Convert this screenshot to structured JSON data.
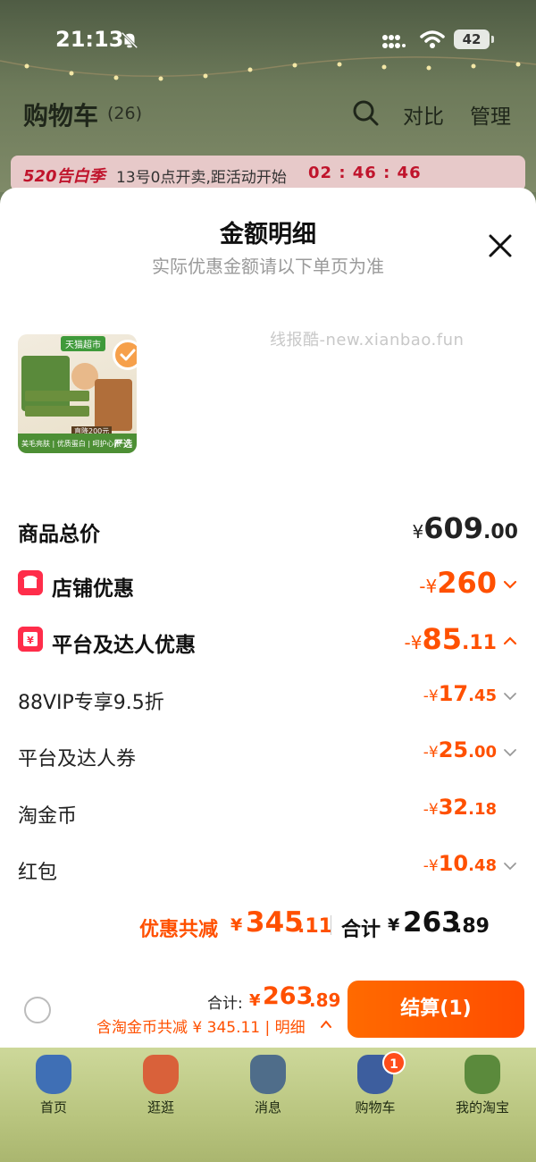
{
  "status_bar": {
    "time": "21:13",
    "battery": "42"
  },
  "cart_header": {
    "title": "购物车",
    "count": "(26)",
    "compare_label": "对比",
    "manage_label": "管理"
  },
  "promo": {
    "tag": "520告白季",
    "text": "13号0点开卖,距活动开始",
    "timer": "02 : 46 : 46"
  },
  "sheet": {
    "title": "金额明细",
    "subtitle": "实际优惠金额请以下单页为准",
    "watermark": "线报酷-new.xianbao.fun",
    "product_image": {
      "store_badge": "天猫超市",
      "tag": "直降200元",
      "footer": "美毛亮肤 | 优质蛋白 | 呵护心眼",
      "select_badge": "严选"
    },
    "rows": [
      {
        "label": "商品总价",
        "yen": "¥",
        "int": "609",
        "dec": ".00"
      },
      {
        "label": "店铺优惠",
        "icon": "store-discount-icon",
        "yen": "-¥",
        "int": "260",
        "dec": ""
      },
      {
        "label": "平台及达人优惠",
        "icon": "coupon-icon",
        "yen": "-¥",
        "int": "85",
        "dec": ".11"
      },
      {
        "label": "88VIP专享9.5折",
        "yen": "-¥",
        "int": "17",
        "dec": ".45"
      },
      {
        "label": "平台及达人券",
        "yen": "-¥",
        "int": "25",
        "dec": ".00"
      },
      {
        "label": "淘金币",
        "yen": "-¥",
        "int": "32",
        "dec": ".18"
      },
      {
        "label": "红包",
        "yen": "-¥",
        "int": "10",
        "dec": ".48"
      }
    ],
    "summary": {
      "discount_label": "优惠共减",
      "discount_yen": "¥",
      "discount_int": "345",
      "discount_dec": ".11",
      "total_label": "合计",
      "total_yen": "¥",
      "total_int": "263",
      "total_dec": ".89"
    }
  },
  "checkout": {
    "total_label": "合计:",
    "total_yen": "¥",
    "total_int": "263",
    "total_dec": ".89",
    "detail": "含淘金币共减 ¥ 345.11 | 明细",
    "button": "结算(1)"
  },
  "tabs": [
    {
      "label": "首页",
      "color": "#3f6fb5"
    },
    {
      "label": "逛逛",
      "color": "#d9613a"
    },
    {
      "label": "消息",
      "color": "#4f6d8a"
    },
    {
      "label": "购物车",
      "color": "#3d5e9e",
      "badge": "1"
    },
    {
      "label": "我的淘宝",
      "color": "#5b8a3c"
    }
  ],
  "colors": {
    "accent": "#ff5000",
    "promo_red": "#c0142c",
    "icon_red": "#ff2d4a"
  }
}
